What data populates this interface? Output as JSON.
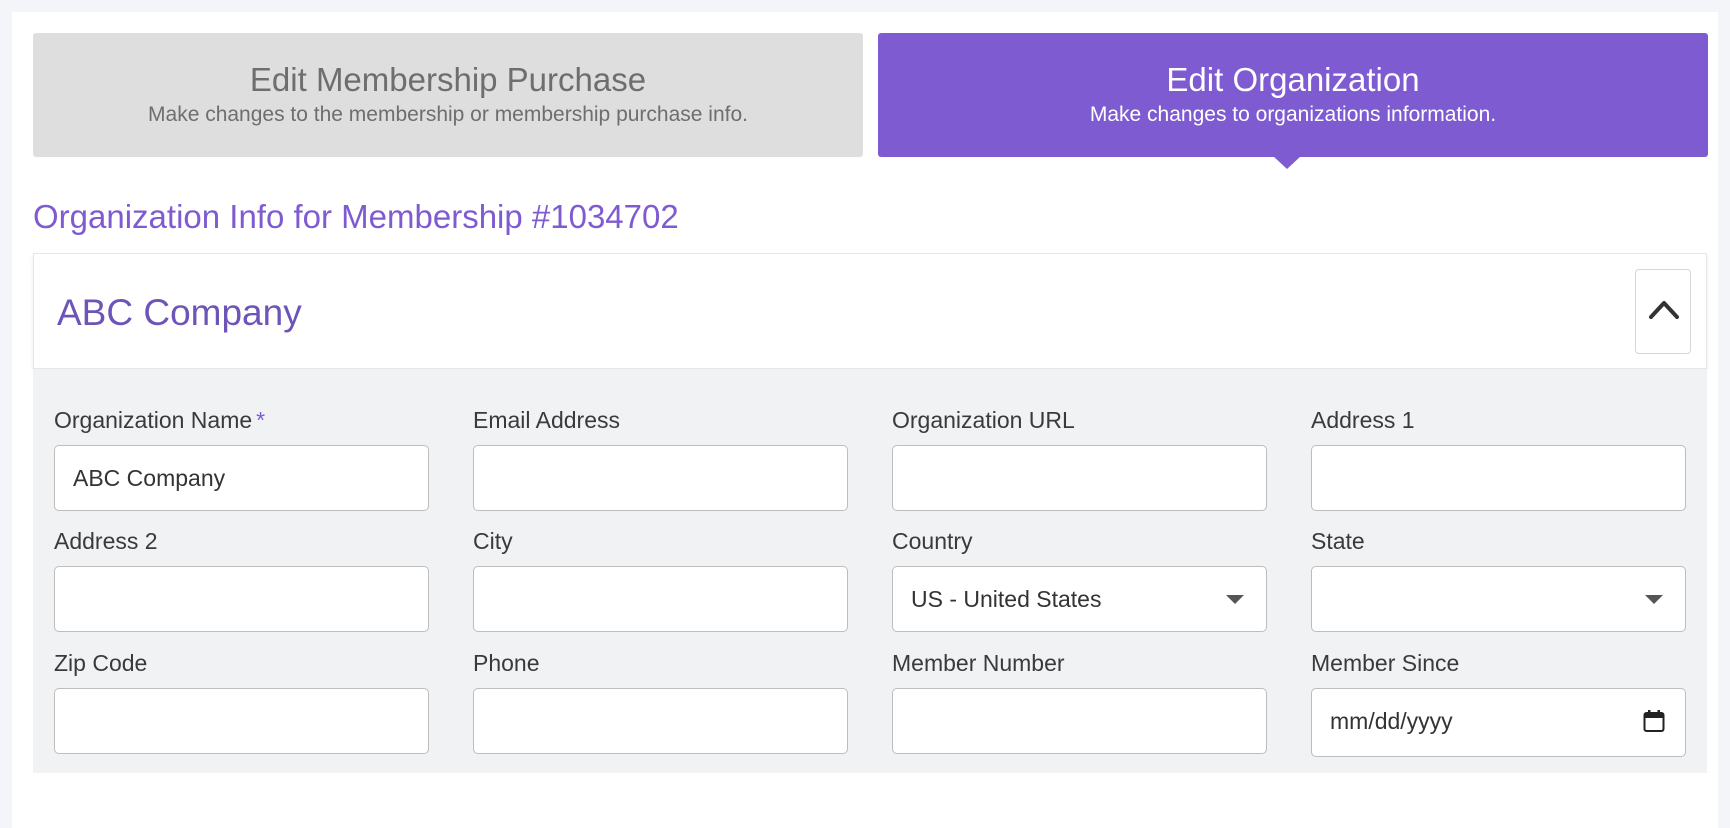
{
  "tabs": [
    {
      "title": "Edit Membership Purchase",
      "subtitle": "Make changes to the membership or membership purchase info.",
      "active": false
    },
    {
      "title": "Edit Organization",
      "subtitle": "Make changes to organizations information.",
      "active": true
    }
  ],
  "section_title": "Organization Info for Membership #1034702",
  "org_card": {
    "heading": "ABC Company",
    "collapse_icon": "chevron-up-icon"
  },
  "form": {
    "org_name": {
      "label": "Organization Name",
      "required_mark": "*",
      "value": "ABC Company"
    },
    "email": {
      "label": "Email Address",
      "value": ""
    },
    "org_url": {
      "label": "Organization URL",
      "value": ""
    },
    "address1": {
      "label": "Address 1",
      "value": ""
    },
    "address2": {
      "label": "Address 2",
      "value": ""
    },
    "city": {
      "label": "City",
      "value": ""
    },
    "country": {
      "label": "Country",
      "value": "US - United States"
    },
    "state": {
      "label": "State",
      "value": ""
    },
    "zip": {
      "label": "Zip Code",
      "value": ""
    },
    "phone": {
      "label": "Phone",
      "value": ""
    },
    "member_number": {
      "label": "Member Number",
      "value": ""
    },
    "member_since": {
      "label": "Member Since",
      "placeholder": "mm/dd/yyyy",
      "icon": "calendar-icon"
    }
  },
  "colors": {
    "accent": "#7f5bd1",
    "inactive_tab": "#dedede",
    "form_bg": "#f1f2f4"
  }
}
